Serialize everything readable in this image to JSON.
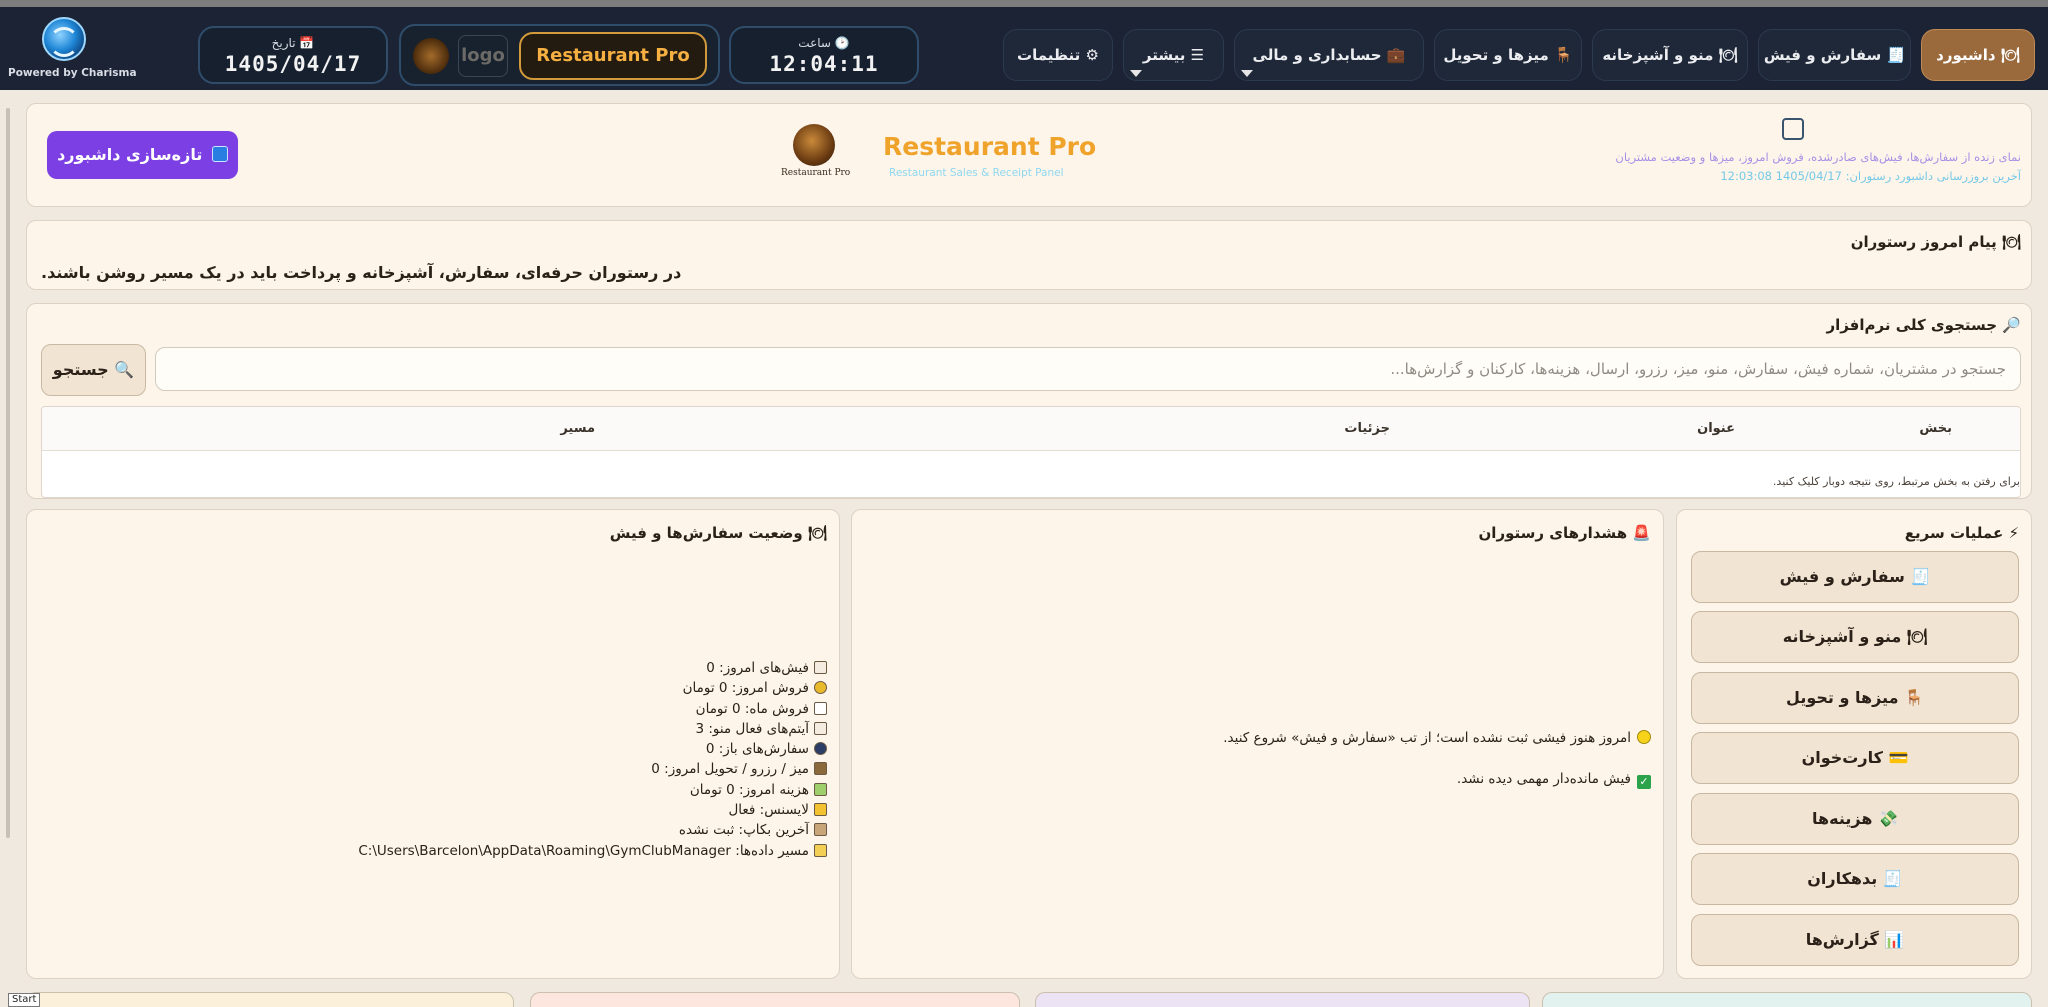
{
  "brand": {
    "powered_by": "Powered by Charisma"
  },
  "topbar": {
    "date_label": "📅 تاریخ",
    "date_value": "1405/04/17",
    "time_label": "🕑 ساعت",
    "time_value": "12:04:11",
    "logo_word": "logo",
    "product_name": "Restaurant Pro",
    "nav": [
      {
        "label": "🍽 داشبورد",
        "active": true
      },
      {
        "label": "🧾 سفارش و فیش"
      },
      {
        "label": "🍽 منو و آشپزخانه"
      },
      {
        "label": "🪑 میزها و تحویل"
      },
      {
        "label": "💼 حسابداری و مالی"
      },
      {
        "label": "☰ بیشتر"
      },
      {
        "label": "⚙ تنظیمات"
      }
    ]
  },
  "header": {
    "refresh_label": "تازه‌سازی داشبورد",
    "emblem_caption": "Restaurant Pro",
    "title": "Restaurant Pro",
    "subtitle": "Restaurant Sales & Receipt Panel",
    "description": "نمای زنده از سفارش‌ها، فیش‌های صادرشده، فروش امروز، میزها و وضعیت مشتریان",
    "last_update": "آخرین بروزرسانی داشبورد رستوران: 1405/04/17 12:03:08"
  },
  "message": {
    "title": "🍽 پیام امروز رستوران",
    "text": "در رستوران حرفه‌ای، سفارش، آشپزخانه و پرداخت باید در یک مسیر روشن باشند."
  },
  "search": {
    "title": "🔎 جستجوی کلی نرم‌افزار",
    "placeholder": "جستجو در مشتریان، شماره فیش، سفارش، منو، میز، رزرو، ارسال، هزینه‌ها، کارکنان و گزارش‌ها...",
    "button": "🔍 جستجو",
    "columns": {
      "section": "بخش",
      "title": "عنوان",
      "details": "جزئیات",
      "path": "مسیر"
    },
    "hint": "برای رفتن به بخش مرتبط، روی نتیجه دوبار کلیک کنید."
  },
  "quick_actions": {
    "title": "⚡ عملیات سریع",
    "buttons": [
      "🧾 سفارش و فیش",
      "🍽 منو و آشپزخانه",
      "🪑 میزها و تحویل",
      "💳 کارت‌خوان",
      "💸 هزینه‌ها",
      "🧾 بدهکاران",
      "📊 گزارش‌ها"
    ]
  },
  "alerts": {
    "title": "🚨 هشدارهای رستوران",
    "items": [
      "امروز هنوز فیشی ثبت نشده است؛ از تب «سفارش و فیش» شروع کنید.",
      "فیش مانده‌دار مهمی دیده نشد."
    ]
  },
  "status": {
    "title": "🍽 وضعیت سفارش‌ها و فیش",
    "lines": [
      "فیش‌های امروز: 0",
      "فروش امروز: 0 تومان",
      "فروش ماه: 0 تومان",
      "آیتم‌های فعال منو: 3",
      "سفارش‌های باز: 0",
      "میز / رزرو / تحویل امروز: 0",
      "هزینه امروز: 0 تومان",
      "لایسنس: فعال",
      "آخرین بکاپ: ثبت نشده",
      "مسیر داده‌ها: C:\\Users\\Barcelon\\AppData\\Roaming\\GymClubManager"
    ]
  },
  "misc": {
    "start_tag": "Start"
  },
  "colors": {
    "accent_purple": "#7b3fe4",
    "accent_orange": "#f0a32b",
    "active_tab": "#9a6a3d",
    "topbar": "#1b2334"
  }
}
